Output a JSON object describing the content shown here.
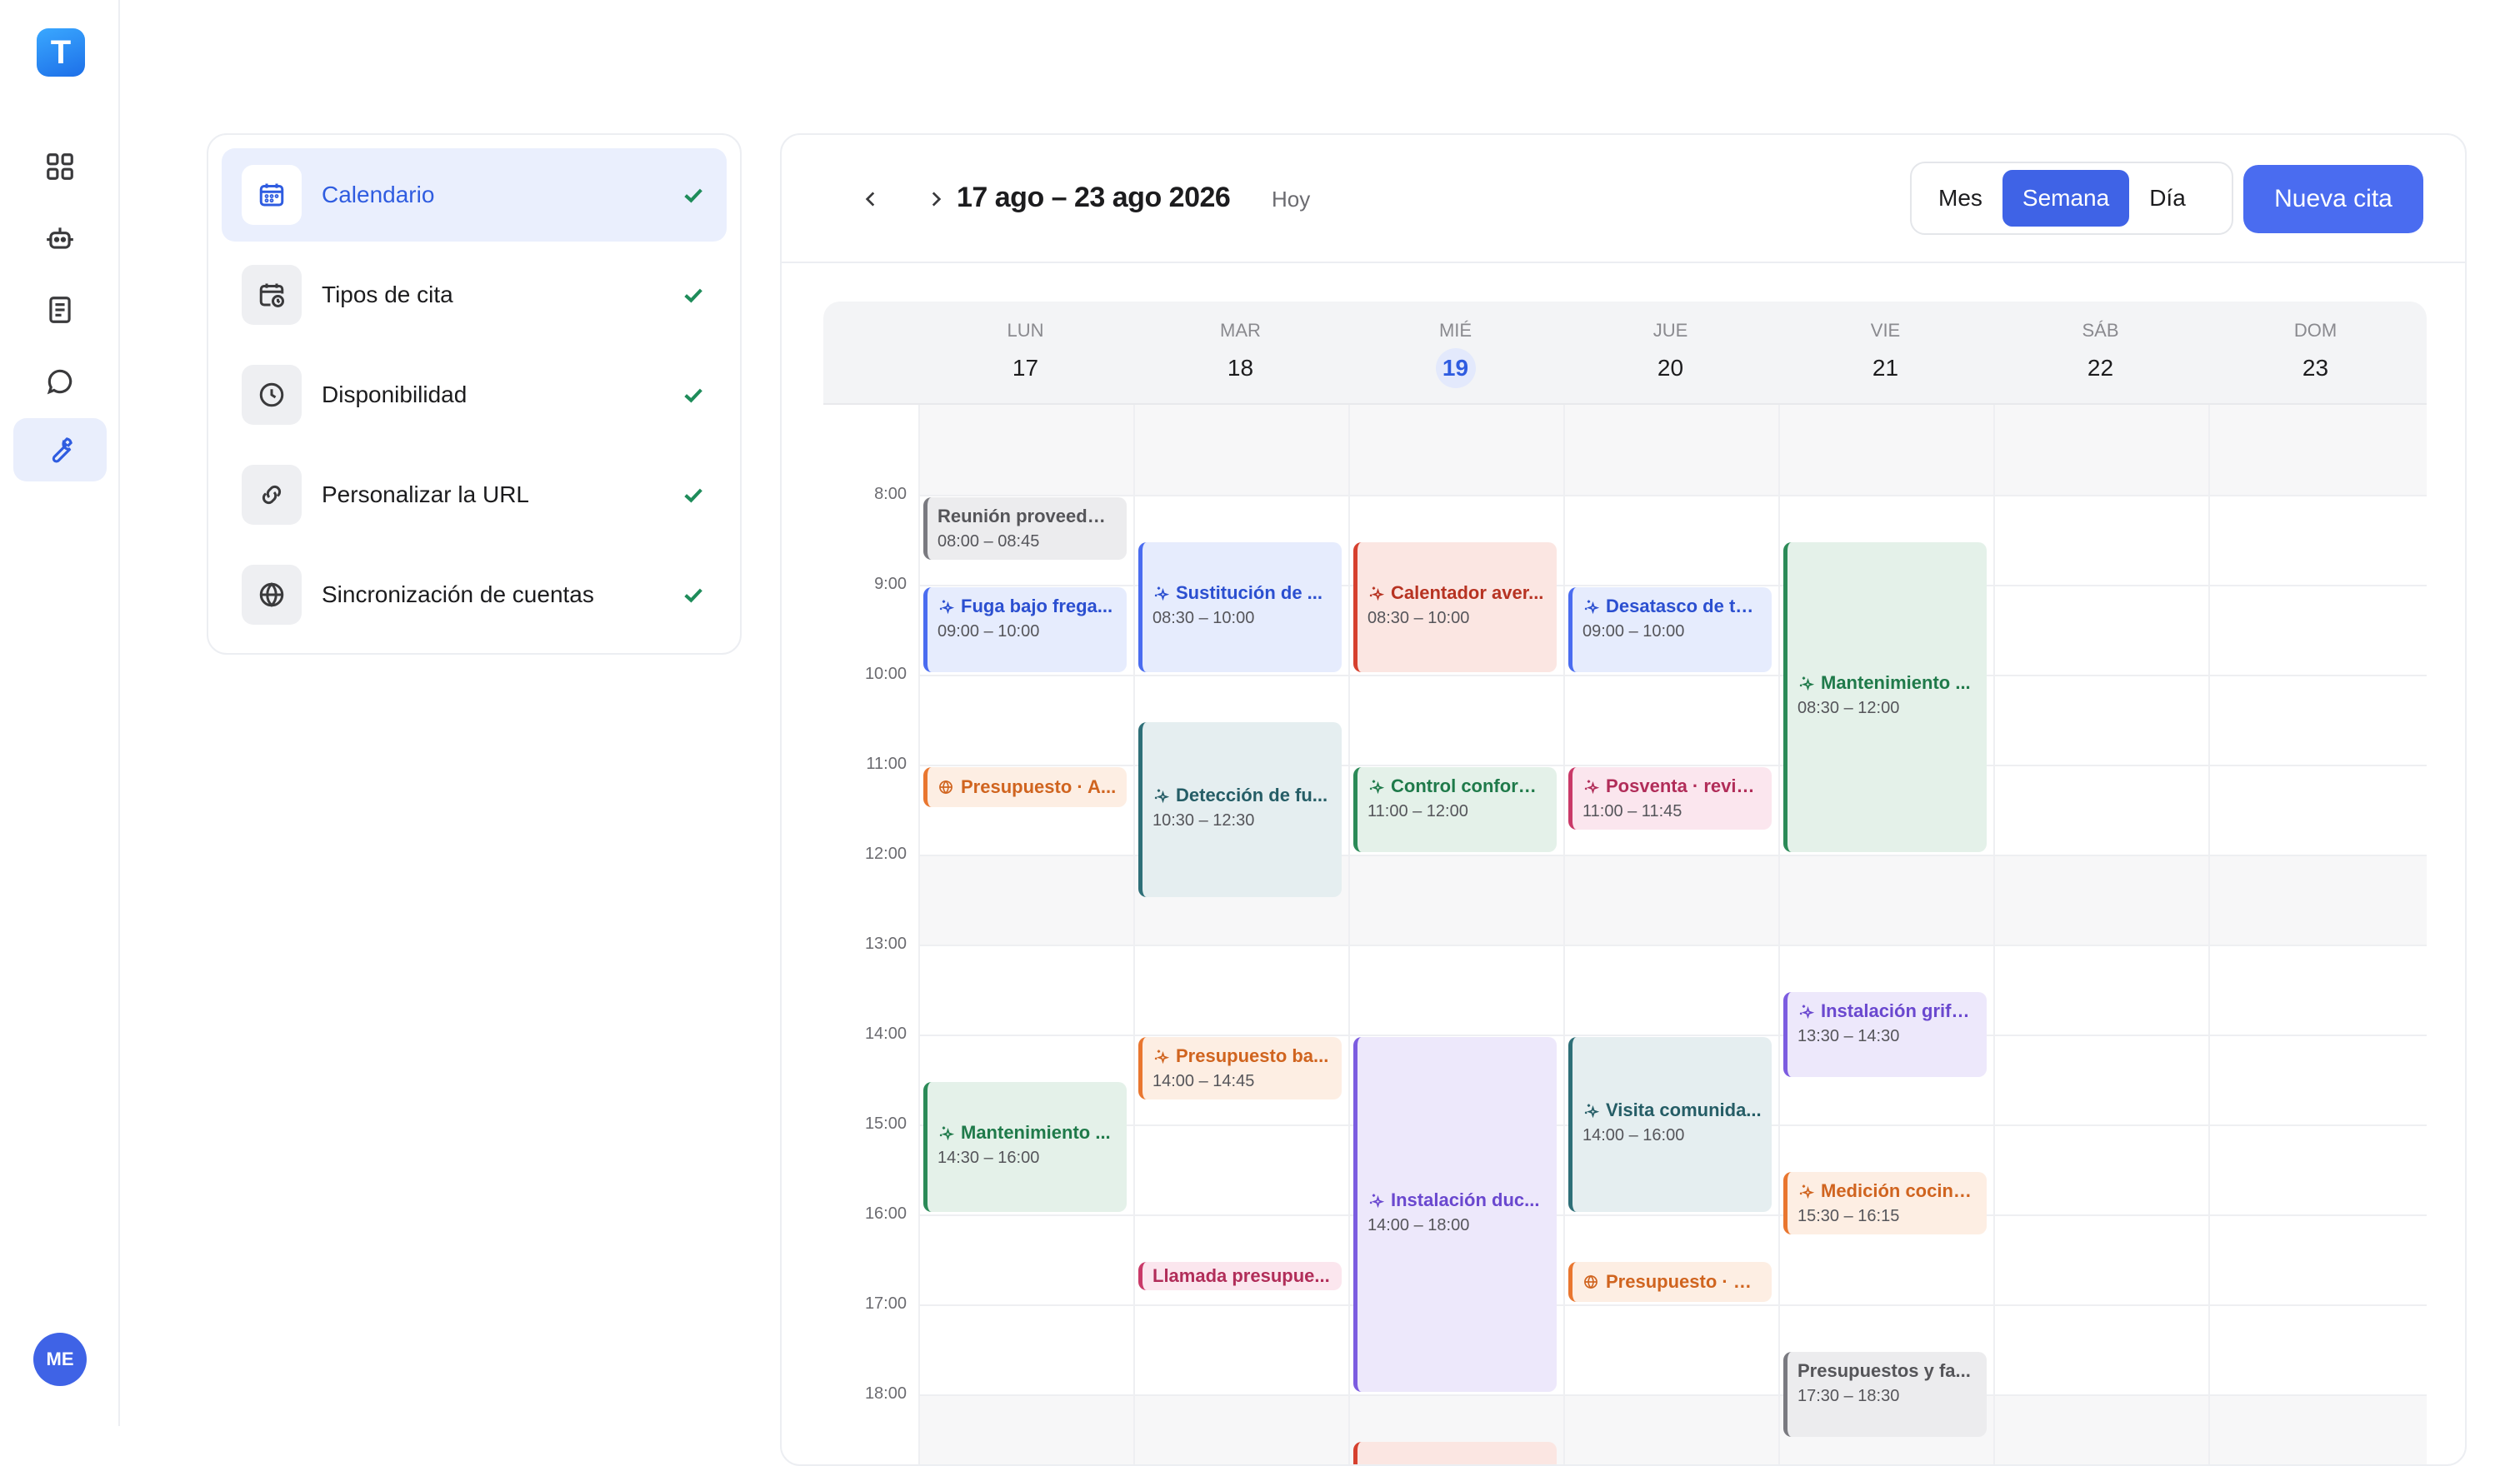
{
  "nav": {
    "logo_letter": "T",
    "items": [
      "grid-icon",
      "robot-icon",
      "document-icon",
      "chat-icon",
      "wrench-icon"
    ],
    "active_index": 4,
    "avatar_initials": "ME"
  },
  "setup_steps": [
    {
      "label": "Calendario",
      "icon": "calendar-icon",
      "active": true,
      "done": true
    },
    {
      "label": "Tipos de cita",
      "icon": "calendar-clock-icon",
      "active": false,
      "done": true
    },
    {
      "label": "Disponibilidad",
      "icon": "clock-icon",
      "active": false,
      "done": true
    },
    {
      "label": "Personalizar la URL",
      "icon": "link-icon",
      "active": false,
      "done": true
    },
    {
      "label": "Sincronización de cuentas",
      "icon": "globe-icon",
      "active": false,
      "done": true
    }
  ],
  "toolbar": {
    "range": "17 ago – 23 ago 2026",
    "today_label": "Hoy",
    "views": [
      "Mes",
      "Semana",
      "Día"
    ],
    "active_view": "Semana",
    "new_button": "Nueva cita"
  },
  "days": [
    {
      "dow": "LUN",
      "num": "17",
      "today": false
    },
    {
      "dow": "MAR",
      "num": "18",
      "today": false
    },
    {
      "dow": "MIÉ",
      "num": "19",
      "today": true
    },
    {
      "dow": "JUE",
      "num": "20",
      "today": false
    },
    {
      "dow": "VIE",
      "num": "21",
      "today": false
    },
    {
      "dow": "SÁB",
      "num": "22",
      "today": false
    },
    {
      "dow": "DOM",
      "num": "23",
      "today": false
    }
  ],
  "hours": [
    "8:00",
    "9:00",
    "10:00",
    "11:00",
    "12:00",
    "13:00",
    "14:00",
    "15:00",
    "16:00",
    "17:00",
    "18:00"
  ],
  "events": [
    {
      "day": 0,
      "start": 8.0,
      "end": 8.75,
      "title": "Reunión proveedor...",
      "time": "08:00 – 08:45",
      "color": "gray",
      "icon": "none"
    },
    {
      "day": 0,
      "start": 9.0,
      "end": 10.0,
      "title": "Fuga bajo frega...",
      "time": "09:00 – 10:00",
      "color": "blue",
      "icon": "sparkle"
    },
    {
      "day": 0,
      "start": 11.0,
      "end": 11.5,
      "title": "Presupuesto · A...",
      "time": "",
      "color": "orange",
      "icon": "globe"
    },
    {
      "day": 0,
      "start": 14.5,
      "end": 16.0,
      "title": "Mantenimiento ...",
      "time": "14:30 – 16:00",
      "color": "green",
      "icon": "sparkle"
    },
    {
      "day": 1,
      "start": 8.5,
      "end": 10.0,
      "title": "Sustitución de ...",
      "time": "08:30 – 10:00",
      "color": "blue",
      "icon": "sparkle"
    },
    {
      "day": 1,
      "start": 10.5,
      "end": 12.5,
      "title": "Detección de fu...",
      "time": "10:30 – 12:30",
      "color": "teal",
      "icon": "sparkle"
    },
    {
      "day": 1,
      "start": 14.0,
      "end": 14.75,
      "title": "Presupuesto ba...",
      "time": "14:00 – 14:45",
      "color": "orange",
      "icon": "sparkle"
    },
    {
      "day": 1,
      "start": 16.5,
      "end": 16.85,
      "title": "Llamada presupue...",
      "time": "",
      "color": "pink",
      "icon": "none"
    },
    {
      "day": 2,
      "start": 8.5,
      "end": 10.0,
      "title": "Calentador aver...",
      "time": "08:30 – 10:00",
      "color": "red",
      "icon": "sparkle"
    },
    {
      "day": 2,
      "start": 11.0,
      "end": 12.0,
      "title": "Control conform...",
      "time": "11:00 – 12:00",
      "color": "green",
      "icon": "sparkle"
    },
    {
      "day": 2,
      "start": 14.0,
      "end": 18.0,
      "title": "Instalación duc...",
      "time": "14:00 – 18:00",
      "color": "purple",
      "icon": "sparkle"
    },
    {
      "day": 2,
      "start": 18.5,
      "end": 19.5,
      "title": "",
      "time": "",
      "color": "red",
      "icon": "none"
    },
    {
      "day": 3,
      "start": 9.0,
      "end": 10.0,
      "title": "Desatasco de tu...",
      "time": "09:00 – 10:00",
      "color": "blue",
      "icon": "sparkle"
    },
    {
      "day": 3,
      "start": 11.0,
      "end": 11.75,
      "title": "Posventa · revisi...",
      "time": "11:00 – 11:45",
      "color": "pink",
      "icon": "sparkle"
    },
    {
      "day": 3,
      "start": 14.0,
      "end": 16.0,
      "title": "Visita comunida...",
      "time": "14:00 – 16:00",
      "color": "teal",
      "icon": "sparkle"
    },
    {
      "day": 3,
      "start": 16.5,
      "end": 17.0,
      "title": "Presupuesto · H...",
      "time": "",
      "color": "orange",
      "icon": "globe"
    },
    {
      "day": 4,
      "start": 8.5,
      "end": 12.0,
      "title": "Mantenimiento ...",
      "time": "08:30 – 12:00",
      "color": "green",
      "icon": "sparkle"
    },
    {
      "day": 4,
      "start": 13.5,
      "end": 14.5,
      "title": "Instalación grife...",
      "time": "13:30 – 14:30",
      "color": "purple",
      "icon": "sparkle"
    },
    {
      "day": 4,
      "start": 15.5,
      "end": 16.25,
      "title": "Medición cocina...",
      "time": "15:30 – 16:15",
      "color": "orange",
      "icon": "sparkle"
    },
    {
      "day": 4,
      "start": 17.5,
      "end": 18.5,
      "title": "Presupuestos y fa...",
      "time": "17:30 – 18:30",
      "color": "gray",
      "icon": "none"
    }
  ]
}
